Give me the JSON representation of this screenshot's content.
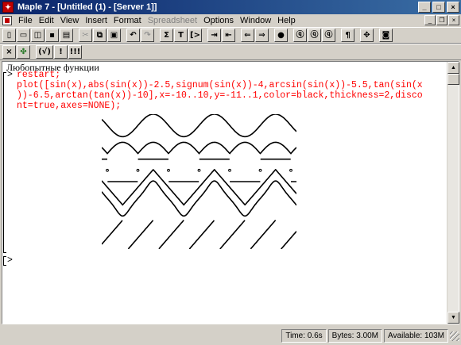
{
  "window": {
    "app_icon": "maple-leaf-icon",
    "title": "Maple 7 - [Untitled (1) - [Server 1]]",
    "buttons": [
      "minimize",
      "maximize",
      "close"
    ]
  },
  "menubar": {
    "items": [
      "File",
      "Edit",
      "View",
      "Insert",
      "Format",
      "Spreadsheet",
      "Options",
      "Window",
      "Help"
    ],
    "disabled": [
      "Spreadsheet"
    ]
  },
  "toolbar1": {
    "icons": [
      "new-icon",
      "open-icon",
      "open-url-icon",
      "save-icon",
      "print-icon",
      "cut-icon",
      "copy-icon",
      "paste-icon",
      "undo-icon",
      "redo-icon",
      "sigma-icon",
      "text-icon",
      "prompt-icon",
      "indent-icon",
      "outdent-icon",
      "back-icon",
      "forward-icon",
      "stop-icon",
      "zoom-100-icon",
      "zoom-200-icon",
      "zoom-400-icon",
      "paragraph-icon",
      "expand-icon",
      "restart-icon"
    ]
  },
  "toolbar2": {
    "buttons": [
      "×",
      "✤",
      "(√)",
      "!",
      "!!!"
    ]
  },
  "worksheet": {
    "section_title": "Любопытные функции",
    "prompt": ">",
    "code_lines": [
      "restart;",
      "plot([sin(x),abs(sin(x))-2.5,signum(sin(x))-4,arcsin(sin(x))-5.5,tan(sin(x",
      "))-6.5,arctan(tan(x))-10],x=-10..10,y=-11..1,color=black,thickness=2,disco",
      "nt=true,axes=NONE);"
    ],
    "empty_prompt": ">",
    "colors": {
      "code": "#ff0000",
      "plot": "#000000",
      "background": "#ffffff"
    }
  },
  "chart_data": {
    "type": "line",
    "x_range": [
      -10,
      10
    ],
    "y_range": [
      -11,
      1
    ],
    "axes": "NONE",
    "color": "black",
    "discont": true,
    "series": [
      {
        "expr": "sin(x)"
      },
      {
        "expr": "abs(sin(x))-2.5"
      },
      {
        "expr": "signum(sin(x))-4"
      },
      {
        "expr": "arcsin(sin(x))-5.5"
      },
      {
        "expr": "tan(sin(x))-6.5"
      },
      {
        "expr": "arctan(tan(x))-10"
      }
    ]
  },
  "statusbar": {
    "time": "Time:  0.6s",
    "bytes": "Bytes: 3.00M",
    "available": "Available: 103M"
  }
}
